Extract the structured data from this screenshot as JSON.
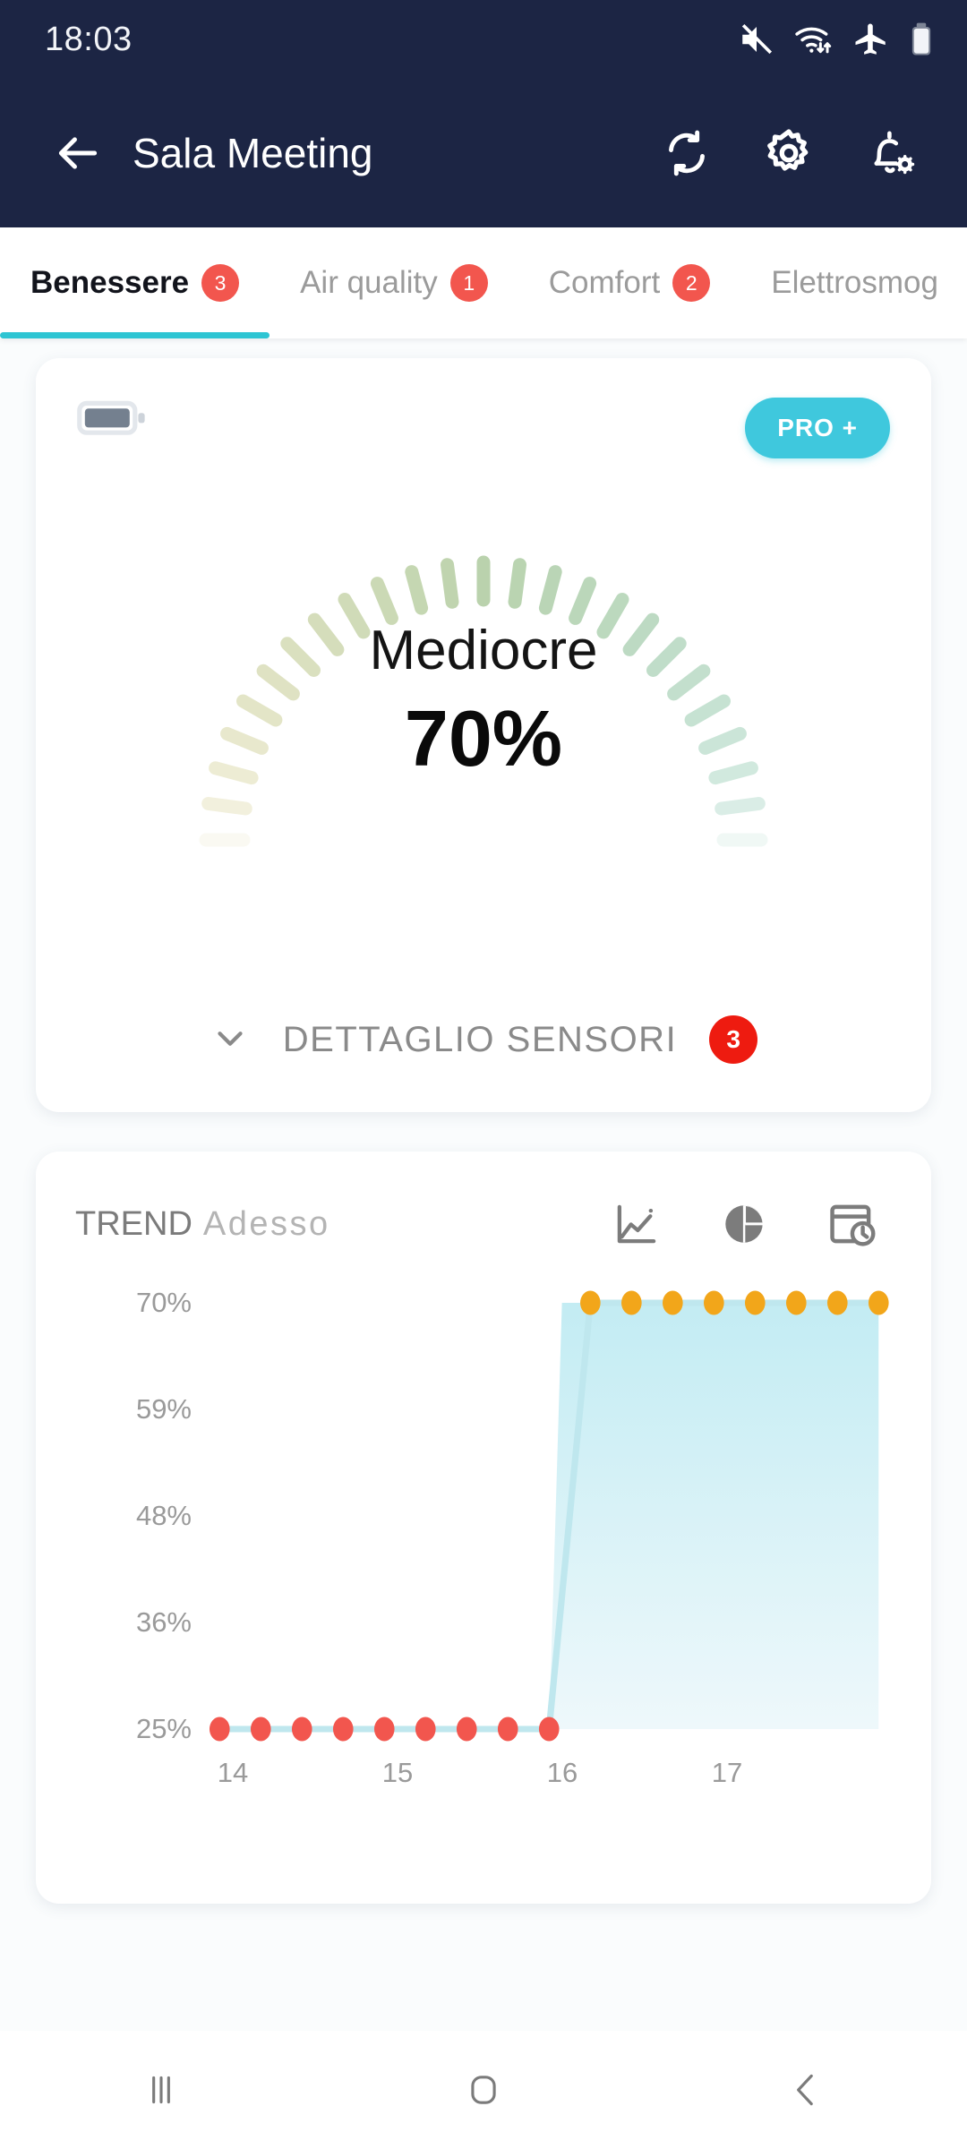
{
  "status_bar": {
    "time": "18:03",
    "icons": [
      "mute-icon",
      "wifi-icon",
      "airplane-mode-icon",
      "battery-icon"
    ]
  },
  "app_bar": {
    "back_icon": "back-arrow-icon",
    "title": "Sala Meeting",
    "actions": [
      "sync-icon",
      "gear-icon",
      "notification-settings-icon"
    ]
  },
  "tabs": [
    {
      "label": "Benessere",
      "badge": "3",
      "active": true
    },
    {
      "label": "Air quality",
      "badge": "1",
      "active": false
    },
    {
      "label": "Comfort",
      "badge": "2",
      "active": false
    },
    {
      "label": "Elettrosmog",
      "badge": "",
      "active": false
    }
  ],
  "gauge_card": {
    "battery_icon": "battery-horizontal-icon",
    "pro_label": "PRO +",
    "quality_label": "Mediocre",
    "quality_value": "70%",
    "detail_chevron": "chevron-down-icon",
    "detail_label": "DETTAGLIO SENSORI",
    "detail_badge": "3",
    "gauge_percent": 70
  },
  "trend_card": {
    "title": "TREND",
    "subtitle": "Adesso",
    "icons": [
      "line-chart-icon",
      "pie-chart-icon",
      "history-calendar-icon"
    ]
  },
  "chart_data": {
    "type": "line",
    "title": "TREND Adesso",
    "xlabel": "",
    "ylabel": "",
    "ylim": [
      25,
      70
    ],
    "grid": false,
    "legend": "none",
    "ytick_labels": [
      "70%",
      "59%",
      "48%",
      "36%",
      "25%"
    ],
    "ytick_values": [
      70,
      59,
      48,
      36,
      25
    ],
    "xtick_labels": [
      "14",
      "15",
      "16",
      "17"
    ],
    "xtick_values": [
      14,
      15,
      16,
      17
    ],
    "series": [
      {
        "name": "Benessere",
        "point_colors": [
          "#f2564e",
          "#f2564e",
          "#f2564e",
          "#f2564e",
          "#f2564e",
          "#f2564e",
          "#f2564e",
          "#f2564e",
          "#f2564e",
          "#f2a61a",
          "#f2a61a",
          "#f2a61a",
          "#f2a61a",
          "#f2a61a",
          "#f2a61a",
          "#f2a61a",
          "#f2a61a"
        ],
        "x": [
          13.92,
          14.17,
          14.42,
          14.67,
          14.92,
          15.17,
          15.42,
          15.67,
          15.92,
          16.17,
          16.42,
          16.67,
          16.92,
          17.17,
          17.42,
          17.67,
          17.92
        ],
        "values": [
          25,
          25,
          25,
          25,
          25,
          25,
          25,
          25,
          25,
          70,
          70,
          70,
          70,
          70,
          70,
          70,
          70
        ]
      }
    ],
    "line_color": "#bfe7ee",
    "area_color": "#cdeef4"
  },
  "nav_bar": {
    "items": [
      "recents-icon",
      "home-icon",
      "back-icon"
    ]
  }
}
